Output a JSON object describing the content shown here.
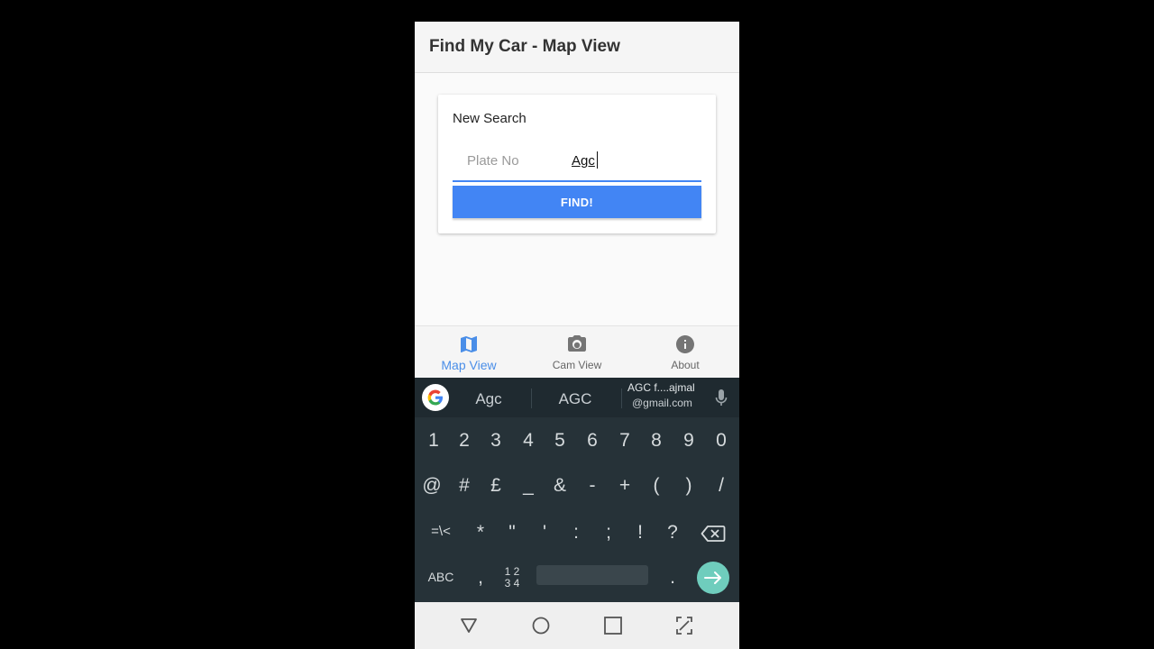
{
  "app": {
    "title": "Find My Car - Map View"
  },
  "card": {
    "title": "New Search",
    "plate_label": "Plate No",
    "plate_value": "Agc",
    "find_button": "FIND!"
  },
  "bottom_nav": [
    {
      "label": "Map View",
      "icon": "map-icon",
      "active": true
    },
    {
      "label": "Cam View",
      "icon": "camera-icon",
      "active": false
    },
    {
      "label": "About",
      "icon": "info-icon",
      "active": false
    }
  ],
  "keyboard": {
    "suggestions": [
      "Agc",
      "AGC"
    ],
    "suggestion_email_line1": "AGC f....ajmal",
    "suggestion_email_line2": "@gmail.com",
    "row1": [
      "1",
      "2",
      "3",
      "4",
      "5",
      "6",
      "7",
      "8",
      "9",
      "0"
    ],
    "row2": [
      "@",
      "#",
      "£",
      "_",
      "&",
      "-",
      "+",
      "(",
      ")",
      "/"
    ],
    "row3": [
      "=\\<",
      "*",
      "\"",
      "'",
      ":",
      ";",
      "!",
      "?"
    ],
    "row4": {
      "abc": "ABC",
      "comma": ",",
      "num_top": "1 2",
      "num_bottom": "3 4",
      "period": "."
    }
  },
  "colors": {
    "accent": "#4285f4",
    "nav_active": "#4a8ee8",
    "keyboard_bg": "#263238",
    "enter_key": "#6fcdbd"
  }
}
